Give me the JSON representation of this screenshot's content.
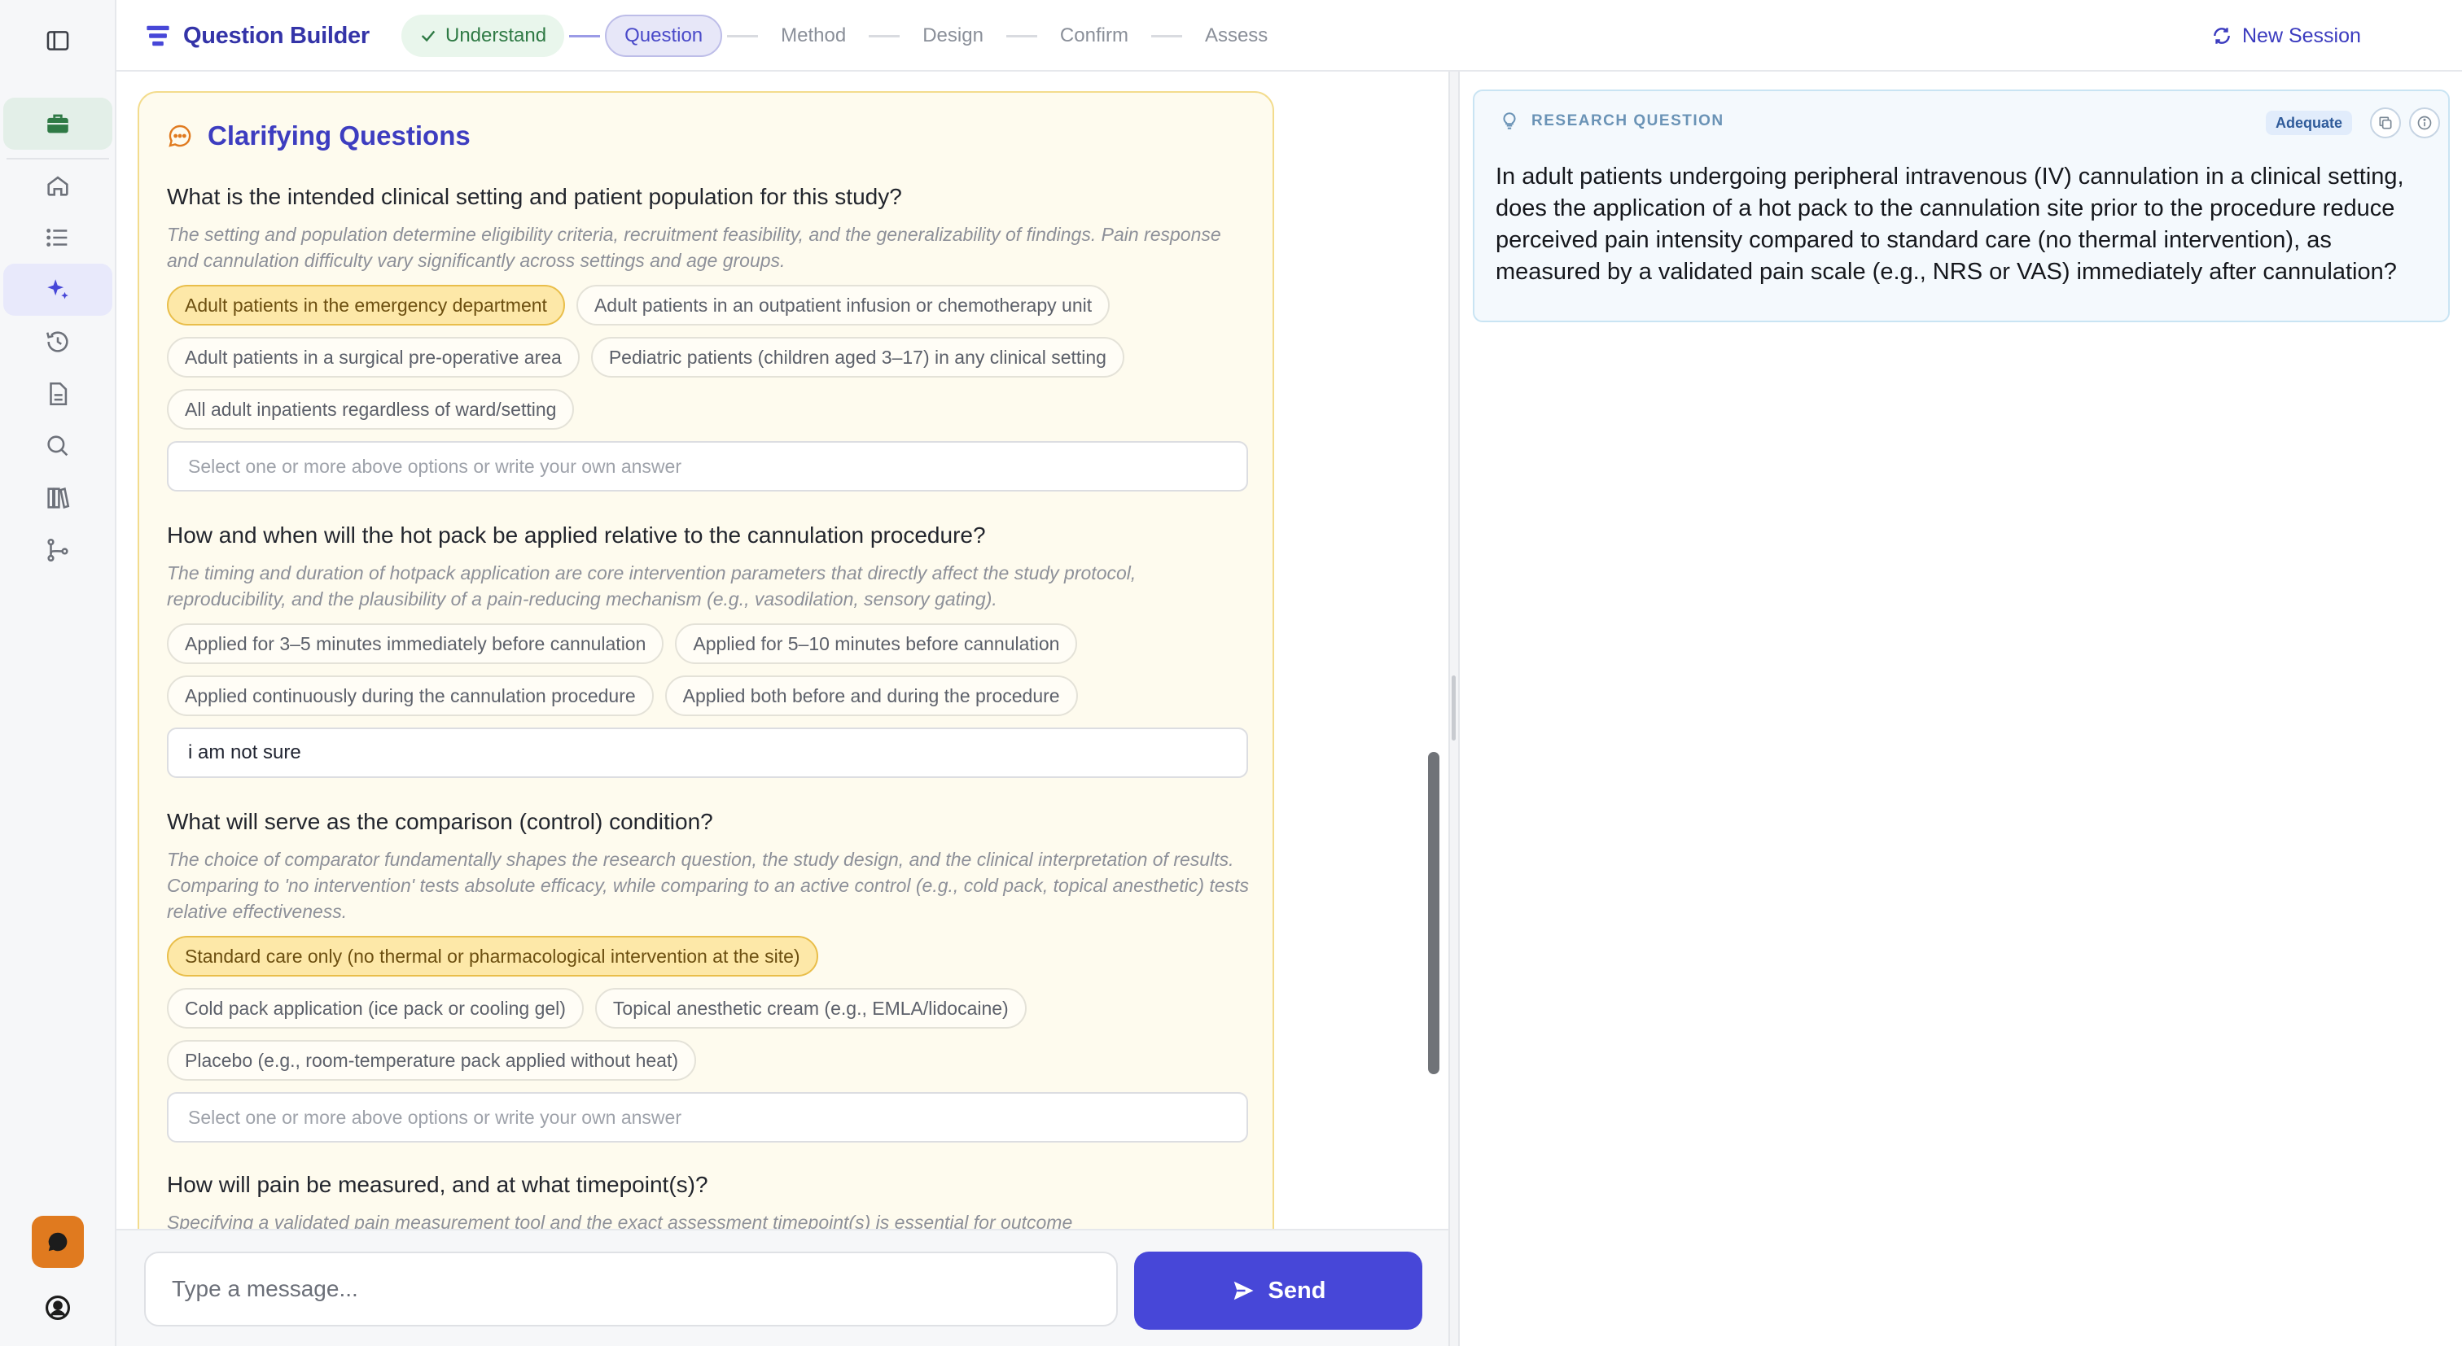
{
  "brand": {
    "title": "Question Builder"
  },
  "steps": [
    {
      "label": "Understand",
      "state": "done"
    },
    {
      "label": "Question",
      "state": "current"
    },
    {
      "label": "Method",
      "state": "todo"
    },
    {
      "label": "Design",
      "state": "todo"
    },
    {
      "label": "Confirm",
      "state": "todo"
    },
    {
      "label": "Assess",
      "state": "todo"
    }
  ],
  "header": {
    "new_session_label": "New Session",
    "info_label": "info"
  },
  "sidebar": {
    "items": [
      {
        "icon": "panel-toggle-icon"
      },
      {
        "icon": "briefcase-icon",
        "active": false
      },
      {
        "icon": "home-icon"
      },
      {
        "icon": "list-icon"
      },
      {
        "icon": "sparkle-icon",
        "active": true
      },
      {
        "icon": "history-icon"
      },
      {
        "icon": "document-icon"
      },
      {
        "icon": "search-icon"
      },
      {
        "icon": "library-icon"
      },
      {
        "icon": "git-branch-icon"
      }
    ],
    "chat_icon": "chat-bubble-icon",
    "user_icon": "user-circle-icon"
  },
  "clarify": {
    "title": "Clarifying Questions",
    "questions": [
      {
        "title": "What is the intended clinical setting and patient population for this study?",
        "description": "The setting and population determine eligibility criteria, recruitment feasibility, and the generalizability of findings. Pain response and cannulation difficulty vary significantly across settings and age groups.",
        "options": [
          {
            "label": "Adult patients in the emergency department",
            "selected": true
          },
          {
            "label": "Adult patients in an outpatient infusion or chemotherapy unit",
            "selected": false
          },
          {
            "label": "Adult patients in a surgical pre-operative area",
            "selected": false
          },
          {
            "label": "Pediatric patients (children aged 3–17) in any clinical setting",
            "selected": false
          },
          {
            "label": "All adult inpatients regardless of ward/setting",
            "selected": false
          }
        ],
        "answer_value": "",
        "answer_placeholder": "Select one or more above options or write your own answer"
      },
      {
        "title": "How and when will the hot pack be applied relative to the cannulation procedure?",
        "description": "The timing and duration of hotpack application are core intervention parameters that directly affect the study protocol, reproducibility, and the plausibility of a pain-reducing mechanism (e.g., vasodilation, sensory gating).",
        "options": [
          {
            "label": "Applied for 3–5 minutes immediately before cannulation",
            "selected": false
          },
          {
            "label": "Applied for 5–10 minutes before cannulation",
            "selected": false
          },
          {
            "label": "Applied continuously during the cannulation procedure",
            "selected": false
          },
          {
            "label": "Applied both before and during the procedure",
            "selected": false
          }
        ],
        "answer_value": "i am not sure",
        "answer_placeholder": "Select one or more above options or write your own answer"
      },
      {
        "title": "What will serve as the comparison (control) condition?",
        "description": "The choice of comparator fundamentally shapes the research question, the study design, and the clinical interpretation of results. Comparing to 'no intervention' tests absolute efficacy, while comparing to an active control (e.g., cold pack, topical anesthetic) tests relative effectiveness.",
        "options": [
          {
            "label": "Standard care only (no thermal or pharmacological intervention at the site)",
            "selected": true
          },
          {
            "label": "Cold pack application (ice pack or cooling gel)",
            "selected": false
          },
          {
            "label": "Topical anesthetic cream (e.g., EMLA/lidocaine)",
            "selected": false
          },
          {
            "label": "Placebo (e.g., room-temperature pack applied without heat)",
            "selected": false
          }
        ],
        "answer_value": "",
        "answer_placeholder": "Select one or more above options or write your own answer"
      },
      {
        "title": "How will pain be measured, and at what timepoint(s)?",
        "description": "Specifying a validated pain measurement tool and the exact assessment timepoint(s) is essential for outcome"
      }
    ]
  },
  "composer": {
    "placeholder": "Type a message...",
    "send_label": "Send"
  },
  "research_question": {
    "label": "RESEARCH QUESTION",
    "badge": "Adequate",
    "text": "In adult patients undergoing peripheral intravenous (IV) cannulation in a clinical setting, does the application of a hot pack to the cannulation site prior to the procedure reduce perceived pain intensity compared to standard care (no thermal intervention), as measured by a validated pain scale (e.g., NRS or VAS) immediately after cannulation?"
  },
  "colors": {
    "accent": "#4747d8",
    "selected_chip": "#fde8a8",
    "card_bg": "#fefbee",
    "done_step": "#2f7a45"
  }
}
